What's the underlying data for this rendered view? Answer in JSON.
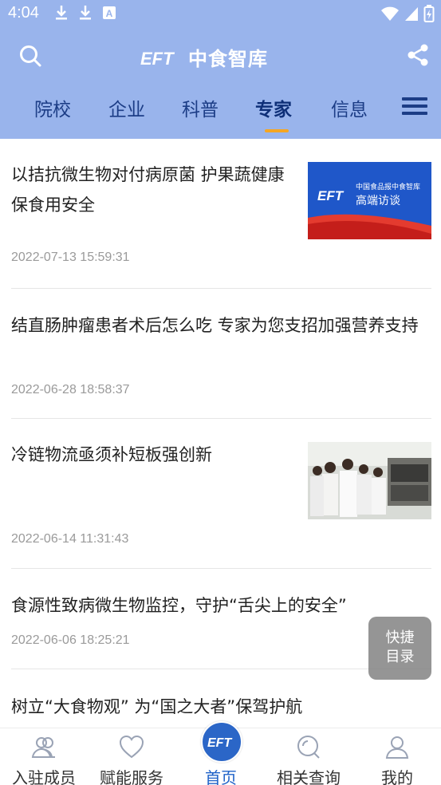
{
  "status_bar": {
    "time": "4:04"
  },
  "app": {
    "logo_text": "中食智库",
    "logo_mark": "EFT"
  },
  "nav": {
    "tabs": [
      {
        "label": "院校"
      },
      {
        "label": "企业"
      },
      {
        "label": "科普"
      },
      {
        "label": "专家",
        "active": true
      },
      {
        "label": "信息"
      }
    ]
  },
  "articles": [
    {
      "title": "以拮抗微生物对付病原菌 护果蔬健康保食用安全",
      "time": "2022-07-13 15:59:31",
      "thumbnail": {
        "line1": "中国食品报中食智库",
        "line2": "高端访谈"
      }
    },
    {
      "title": "结直肠肿瘤患者术后怎么吃 专家为您支招加强营养支持",
      "time": "2022-06-28 18:58:37"
    },
    {
      "title": "冷链物流亟须补短板强创新",
      "time": "2022-06-14 11:31:43",
      "thumbnail": {
        "kind": "lab-photo"
      }
    },
    {
      "title": "食源性致病微生物监控，守护“舌尖上的安全”",
      "time": "2022-06-06 18:25:21"
    },
    {
      "title": "树立“大食物观” 为“国之大者”保驾护航"
    }
  ],
  "quick_menu": {
    "line1": "快捷",
    "line2": "目录"
  },
  "bottom_nav": {
    "items": [
      {
        "label": "入驻成员",
        "icon": "members-icon"
      },
      {
        "label": "赋能服务",
        "icon": "heart-icon"
      },
      {
        "label": "首页",
        "icon": "home-logo-icon",
        "active": true
      },
      {
        "label": "相关查询",
        "icon": "query-icon"
      },
      {
        "label": "我的",
        "icon": "profile-icon"
      }
    ]
  },
  "colors": {
    "header_bg": "#99b4ec",
    "nav_text": "#1c3d86",
    "accent": "#f5a623",
    "active_tab": "#1d61c8"
  }
}
